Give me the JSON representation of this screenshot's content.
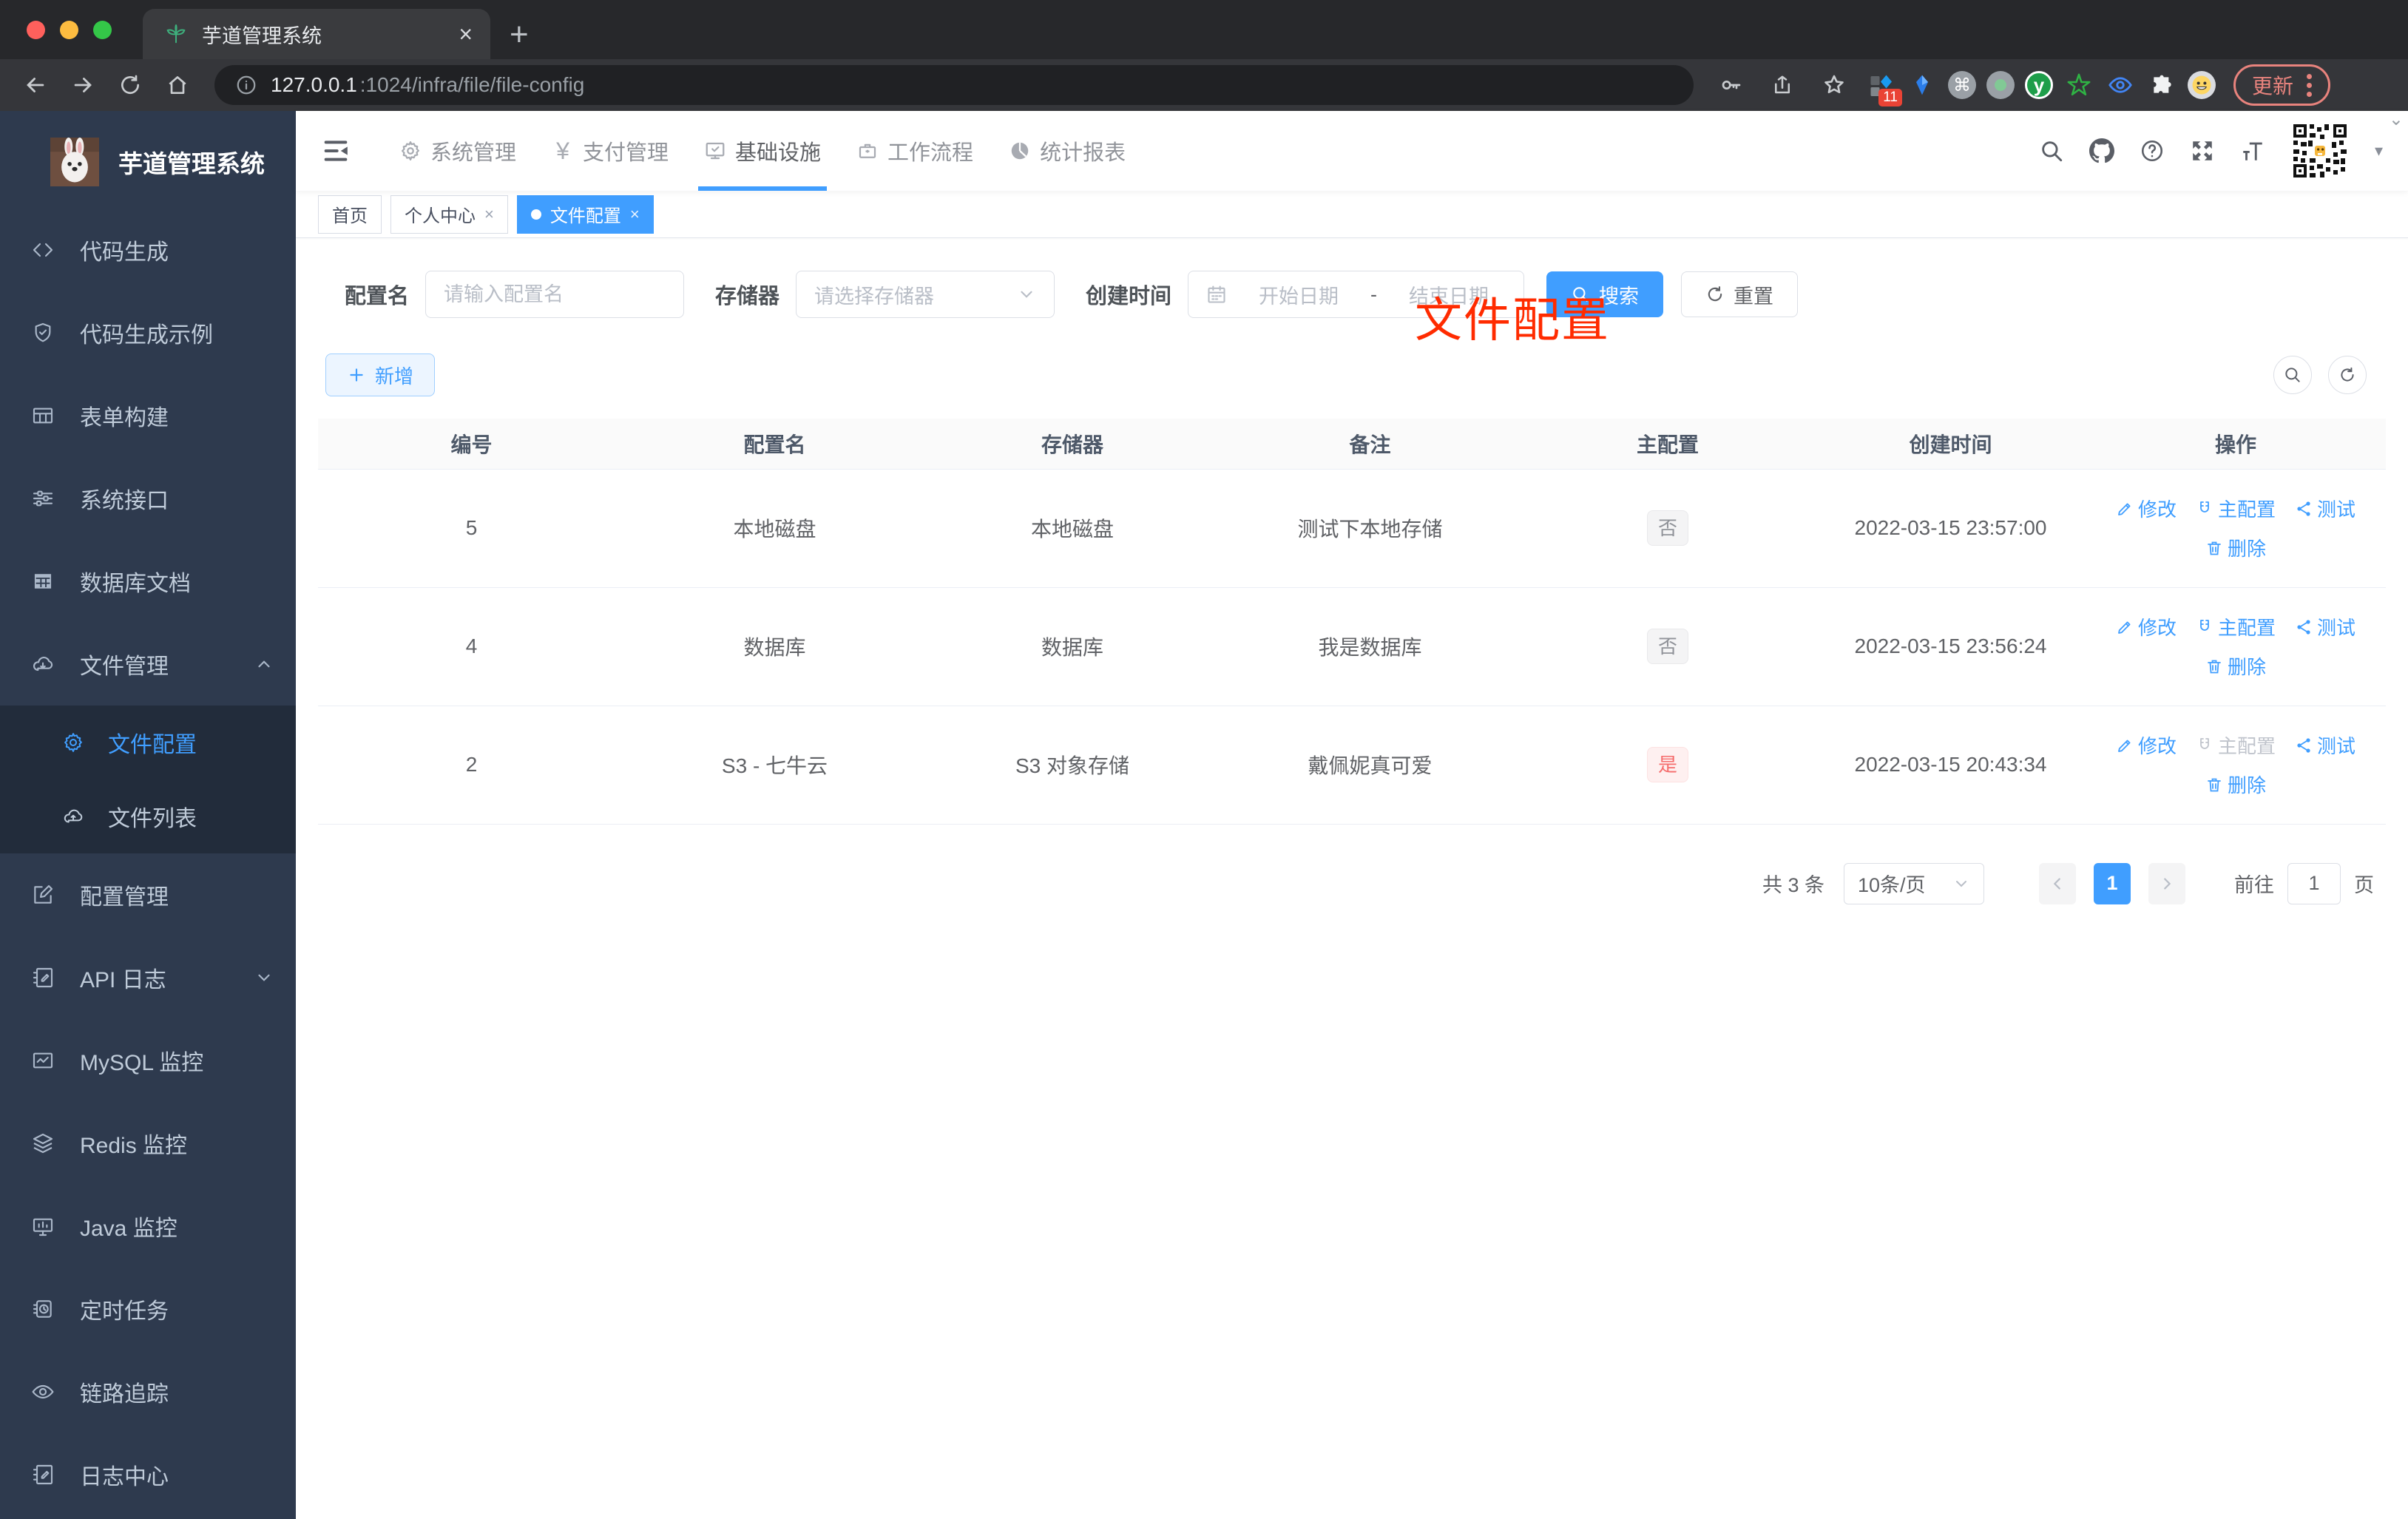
{
  "colors": {
    "accent": "#409eff",
    "danger": "#f56c6c",
    "overlay_red": "#ff2b00",
    "sidebar_bg": "#2e3a4e",
    "submenu_bg": "#222c3b"
  },
  "icons": {
    "close": "×",
    "plus": "+",
    "dot": "●",
    "yen": "¥",
    "command": "⌘",
    "caret_down": "▾",
    "chrome_caret": "⌄",
    "ext_y": "y"
  },
  "browser": {
    "tab_title": "芋道管理系统",
    "url_host": "127.0.0.1",
    "url_path": ":1024/infra/file/file-config",
    "extension_badge": "11",
    "update_label": "更新"
  },
  "sidebar": {
    "logo_title": "芋道管理系统",
    "items": [
      {
        "label": "代码生成"
      },
      {
        "label": "代码生成示例"
      },
      {
        "label": "表单构建"
      },
      {
        "label": "系统接口"
      },
      {
        "label": "数据库文档"
      },
      {
        "label": "文件管理"
      }
    ],
    "file_submenu": [
      {
        "label": "文件配置"
      },
      {
        "label": "文件列表"
      }
    ],
    "items_bottom": [
      {
        "label": "配置管理"
      },
      {
        "label": "API 日志"
      },
      {
        "label": "MySQL 监控"
      },
      {
        "label": "Redis 监控"
      },
      {
        "label": "Java 监控"
      },
      {
        "label": "定时任务"
      },
      {
        "label": "链路追踪"
      },
      {
        "label": "日志中心"
      }
    ]
  },
  "topnav": {
    "items": [
      "系统管理",
      "支付管理",
      "基础设施",
      "工作流程",
      "统计报表"
    ]
  },
  "tags": [
    {
      "label": "首页"
    },
    {
      "label": "个人中心"
    },
    {
      "label": "文件配置"
    }
  ],
  "overlay_text": "文件配置",
  "filter": {
    "name_label": "配置名",
    "name_placeholder": "请输入配置名",
    "storage_label": "存储器",
    "storage_placeholder": "请选择存储器",
    "date_label": "创建时间",
    "date_start_placeholder": "开始日期",
    "range_separator": "-",
    "date_end_placeholder": "结束日期",
    "search_label": "搜索",
    "reset_label": "重置"
  },
  "toolbar": {
    "add_label": "新增"
  },
  "table": {
    "columns": [
      "编号",
      "配置名",
      "存储器",
      "备注",
      "主配置",
      "创建时间",
      "操作"
    ],
    "actions": {
      "edit": "修改",
      "master": "主配置",
      "test": "测试",
      "delete": "删除"
    },
    "rows": [
      {
        "id": "5",
        "name": "本地磁盘",
        "storage": "本地磁盘",
        "remark": "测试下本地存储",
        "primary": "否",
        "created": "2022-03-15 23:57:00"
      },
      {
        "id": "4",
        "name": "数据库",
        "storage": "数据库",
        "remark": "我是数据库",
        "primary": "否",
        "created": "2022-03-15 23:56:24"
      },
      {
        "id": "2",
        "name": "S3 - 七牛云",
        "storage": "S3 对象存储",
        "remark": "戴佩妮真可爱",
        "primary": "是",
        "created": "2022-03-15 20:43:34"
      }
    ]
  },
  "pagination": {
    "total": "共 3 条",
    "page_size": "10条/页",
    "current_page": "1",
    "goto_label": "前往",
    "goto_value": "1",
    "page_unit": "页"
  }
}
